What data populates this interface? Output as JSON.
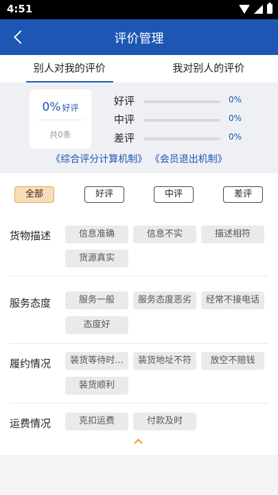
{
  "status_bar": {
    "time": "4:51"
  },
  "header": {
    "title": "评价管理",
    "back_icon": "back-arrow-icon"
  },
  "tabs": [
    {
      "label": "别人对我的评价",
      "active": true
    },
    {
      "label": "我对别人的评价",
      "active": false
    }
  ],
  "summary": {
    "percent": "0%",
    "percent_label": "好评",
    "total": "共0条",
    "bars": [
      {
        "label": "好评",
        "value": "0%",
        "fraction": 0
      },
      {
        "label": "中评",
        "value": "0%",
        "fraction": 0
      },
      {
        "label": "差评",
        "value": "0%",
        "fraction": 0
      }
    ],
    "links": [
      "《综合评分计算机制》",
      "《会员退出机制》"
    ]
  },
  "filters": [
    {
      "label": "全部",
      "active": true
    },
    {
      "label": "好评",
      "active": false
    },
    {
      "label": "中评",
      "active": false
    },
    {
      "label": "差评",
      "active": false
    }
  ],
  "categories": [
    {
      "label": "货物描述",
      "tags": [
        "信息准确",
        "信息不实",
        "描述相符",
        "货源真实"
      ]
    },
    {
      "label": "服务态度",
      "tags": [
        "服务一般",
        "服务态度恶劣",
        "经常不接电话",
        "态度好"
      ]
    },
    {
      "label": "履约情况",
      "tags": [
        "装货等待时...",
        "装货地址不符",
        "放空不赔钱",
        "装货顺利"
      ]
    },
    {
      "label": "运费情况",
      "tags": [
        "克扣运费",
        "付款及时"
      ]
    }
  ],
  "colors": {
    "primary": "#1e56b4",
    "accent": "#f0962c",
    "filter_active": "#f8dcb8"
  },
  "collapse_icon": "chevron-up-icon"
}
